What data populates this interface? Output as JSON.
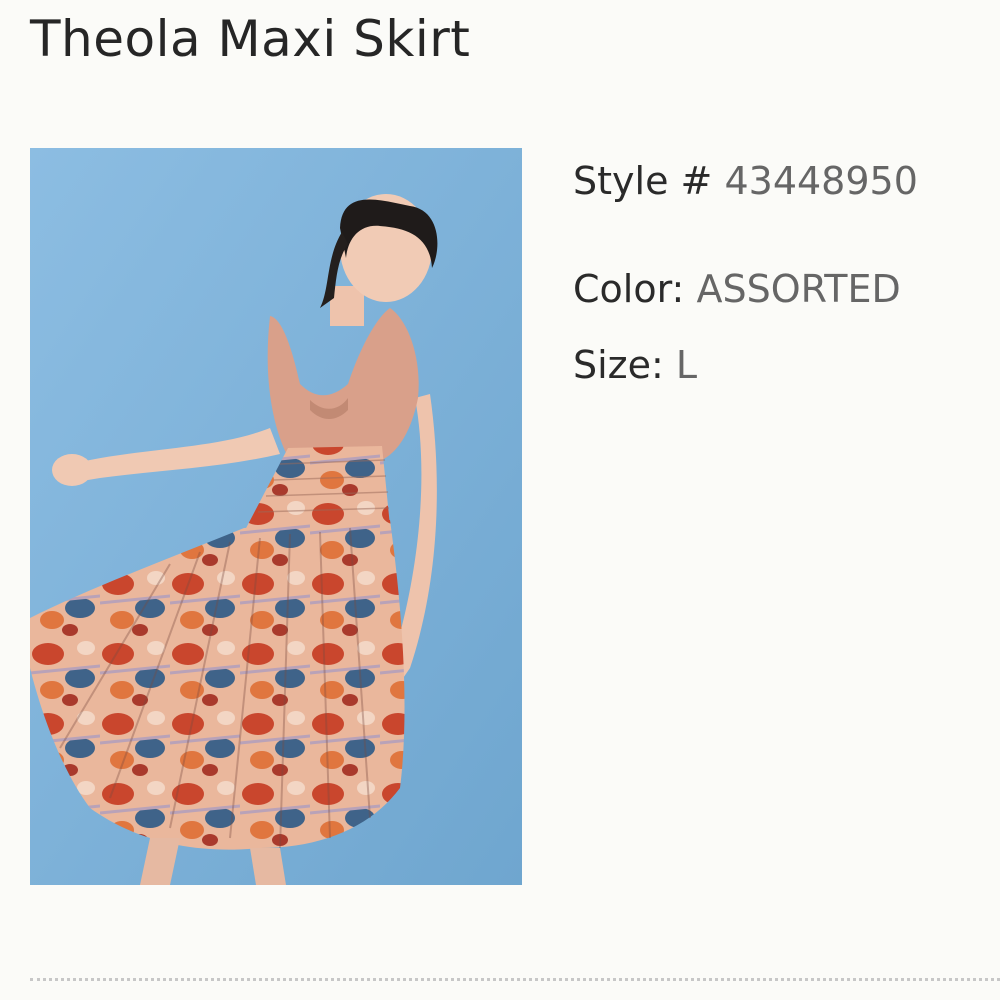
{
  "product": {
    "title": "Theola Maxi Skirt",
    "image_alt": "Model wearing Theola Maxi Skirt"
  },
  "details": {
    "style_label": "Style #",
    "style_value": "43448950",
    "color_label": "Color:",
    "color_value": "ASSORTED",
    "size_label": "Size:",
    "size_value": "L"
  },
  "colors": {
    "photo_background": "#7fb2d8",
    "bodice": "#d9a08a",
    "skirt_base": "#e9b49a",
    "skirt_red": "#c8452c",
    "skirt_blue": "#3c5f87"
  }
}
